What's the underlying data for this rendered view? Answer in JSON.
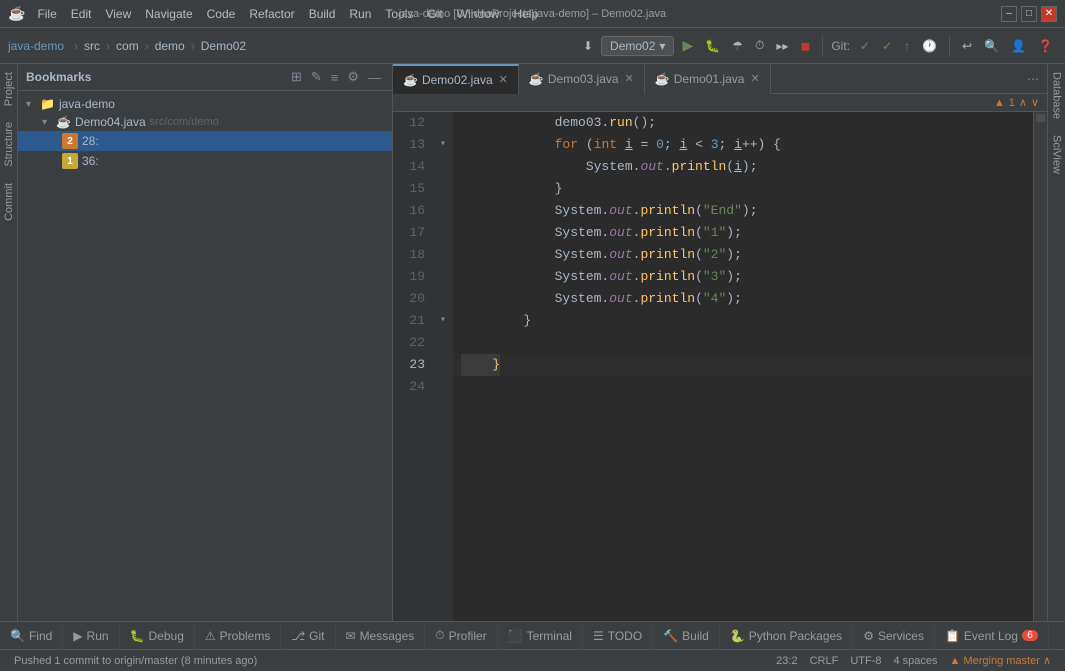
{
  "titlebar": {
    "app_icon": "☕",
    "menus": [
      "File",
      "Edit",
      "View",
      "Navigate",
      "Code",
      "Refactor",
      "Build",
      "Run",
      "Tools",
      "Git",
      "Window",
      "Help"
    ],
    "title": "java-demo [D:\\IdeaProjects\\java-demo] – Demo02.java",
    "min_label": "–",
    "max_label": "□",
    "close_label": "✕"
  },
  "toolbar": {
    "project_name": "java-demo",
    "breadcrumbs": [
      "src",
      "com",
      "demo",
      "Demo02"
    ],
    "run_config": "Demo02",
    "git_label": "Git:",
    "warning_count": "▲ 1"
  },
  "bookmarks": {
    "title": "Bookmarks",
    "root_label": "java-demo",
    "nodes": [
      {
        "label": "Demo04.java",
        "sublabel": "src/com/demo",
        "expanded": true,
        "children": [
          {
            "num": "2",
            "color": "orange",
            "line": "28:"
          },
          {
            "num": "1",
            "color": "yellow",
            "line": "36:"
          }
        ]
      }
    ]
  },
  "tabs": [
    {
      "label": "Demo02.java",
      "active": true
    },
    {
      "label": "Demo03.java",
      "active": false
    },
    {
      "label": "Demo01.java",
      "active": false
    }
  ],
  "gutter_warning": "▲ 1",
  "code": {
    "lines": [
      {
        "num": "12",
        "indent": "",
        "content": "            demo03.run();",
        "tokens": [
          {
            "text": "            demo03.",
            "type": "plain"
          },
          {
            "text": "run",
            "type": "fn"
          },
          {
            "text": "();",
            "type": "plain"
          }
        ]
      },
      {
        "num": "13",
        "indent": "",
        "content": "            for (int i = 0; i < 3; i++) {",
        "tokens": [
          {
            "text": "            ",
            "type": "plain"
          },
          {
            "text": "for",
            "type": "kw"
          },
          {
            "text": " (",
            "type": "plain"
          },
          {
            "text": "int",
            "type": "kw"
          },
          {
            "text": " i = ",
            "type": "plain"
          },
          {
            "text": "0",
            "type": "num"
          },
          {
            "text": "; i < ",
            "type": "plain"
          },
          {
            "text": "3",
            "type": "num"
          },
          {
            "text": "; i++) {",
            "type": "plain"
          }
        ]
      },
      {
        "num": "14",
        "indent": "",
        "content": "                System.out.println(i);",
        "tokens": [
          {
            "text": "                System.",
            "type": "plain"
          },
          {
            "text": "out",
            "type": "out"
          },
          {
            "text": ".",
            "type": "plain"
          },
          {
            "text": "println",
            "type": "fn"
          },
          {
            "text": "(i);",
            "type": "plain"
          }
        ]
      },
      {
        "num": "15",
        "indent": "",
        "content": "            }",
        "tokens": [
          {
            "text": "            }",
            "type": "plain"
          }
        ]
      },
      {
        "num": "16",
        "indent": "",
        "content": "            System.out.println(\"End\");",
        "tokens": [
          {
            "text": "            System.",
            "type": "plain"
          },
          {
            "text": "out",
            "type": "out"
          },
          {
            "text": ".",
            "type": "plain"
          },
          {
            "text": "println",
            "type": "fn"
          },
          {
            "text": "(",
            "type": "plain"
          },
          {
            "text": "\"End\"",
            "type": "str"
          },
          {
            "text": ");",
            "type": "plain"
          }
        ]
      },
      {
        "num": "17",
        "indent": "",
        "content": "            System.out.println(\"1\");",
        "tokens": [
          {
            "text": "            System.",
            "type": "plain"
          },
          {
            "text": "out",
            "type": "out"
          },
          {
            "text": ".",
            "type": "plain"
          },
          {
            "text": "println",
            "type": "fn"
          },
          {
            "text": "(",
            "type": "plain"
          },
          {
            "text": "\"1\"",
            "type": "str"
          },
          {
            "text": ");",
            "type": "plain"
          }
        ]
      },
      {
        "num": "18",
        "indent": "",
        "content": "            System.out.println(\"2\");",
        "tokens": [
          {
            "text": "            System.",
            "type": "plain"
          },
          {
            "text": "out",
            "type": "out"
          },
          {
            "text": ".",
            "type": "plain"
          },
          {
            "text": "println",
            "type": "fn"
          },
          {
            "text": "(",
            "type": "plain"
          },
          {
            "text": "\"2\"",
            "type": "str"
          },
          {
            "text": ");",
            "type": "plain"
          }
        ]
      },
      {
        "num": "19",
        "indent": "",
        "content": "            System.out.println(\"3\");",
        "tokens": [
          {
            "text": "            System.",
            "type": "plain"
          },
          {
            "text": "out",
            "type": "out"
          },
          {
            "text": ".",
            "type": "plain"
          },
          {
            "text": "println",
            "type": "fn"
          },
          {
            "text": "(",
            "type": "plain"
          },
          {
            "text": "\"3\"",
            "type": "str"
          },
          {
            "text": ");",
            "type": "plain"
          }
        ]
      },
      {
        "num": "20",
        "indent": "",
        "content": "            System.out.println(\"4\");",
        "tokens": [
          {
            "text": "            System.",
            "type": "plain"
          },
          {
            "text": "out",
            "type": "out"
          },
          {
            "text": ".",
            "type": "plain"
          },
          {
            "text": "println",
            "type": "fn"
          },
          {
            "text": "(",
            "type": "plain"
          },
          {
            "text": "\"4\"",
            "type": "str"
          },
          {
            "text": ");",
            "type": "plain"
          }
        ]
      },
      {
        "num": "21",
        "indent": "",
        "content": "        }",
        "tokens": [
          {
            "text": "        }",
            "type": "plain"
          }
        ]
      },
      {
        "num": "22",
        "indent": "",
        "content": "",
        "tokens": []
      },
      {
        "num": "23",
        "indent": "",
        "content": "    }",
        "tokens": [
          {
            "text": "    }",
            "type": "brace-matched"
          }
        ],
        "current": true
      },
      {
        "num": "24",
        "indent": "",
        "content": "",
        "tokens": []
      }
    ]
  },
  "side_labels": {
    "left": [
      "Project",
      "Structure",
      "Commit"
    ],
    "right": [
      "Database",
      "SciView"
    ]
  },
  "status_bar": {
    "left_message": "Pushed 1 commit to origin/master (8 minutes ago)",
    "cursor": "23:2",
    "line_ending": "CRLF",
    "encoding": "UTF-8",
    "indent": "4 spaces",
    "warning": "▲ Merging master ∧"
  },
  "bottom_toolbar": {
    "buttons": [
      {
        "icon": "🔍",
        "label": "Find",
        "badge": null
      },
      {
        "icon": "▶",
        "label": "Run",
        "badge": null
      },
      {
        "icon": "🐛",
        "label": "Debug",
        "badge": null
      },
      {
        "icon": "⚠",
        "label": "Problems",
        "badge": null
      },
      {
        "icon": "⎇",
        "label": "Git",
        "badge": null
      },
      {
        "icon": "✉",
        "label": "Messages",
        "badge": null
      },
      {
        "icon": "⏱",
        "label": "Profiler",
        "badge": null
      },
      {
        "icon": "⬛",
        "label": "Terminal",
        "badge": null
      },
      {
        "icon": "☰",
        "label": "TODO",
        "badge": null
      },
      {
        "icon": "🔨",
        "label": "Build",
        "badge": null
      },
      {
        "icon": "🐍",
        "label": "Python Packages",
        "badge": null
      },
      {
        "icon": "⚙",
        "label": "Services",
        "badge": null
      },
      {
        "icon": "📋",
        "label": "Event Log",
        "badge": "6"
      }
    ]
  }
}
